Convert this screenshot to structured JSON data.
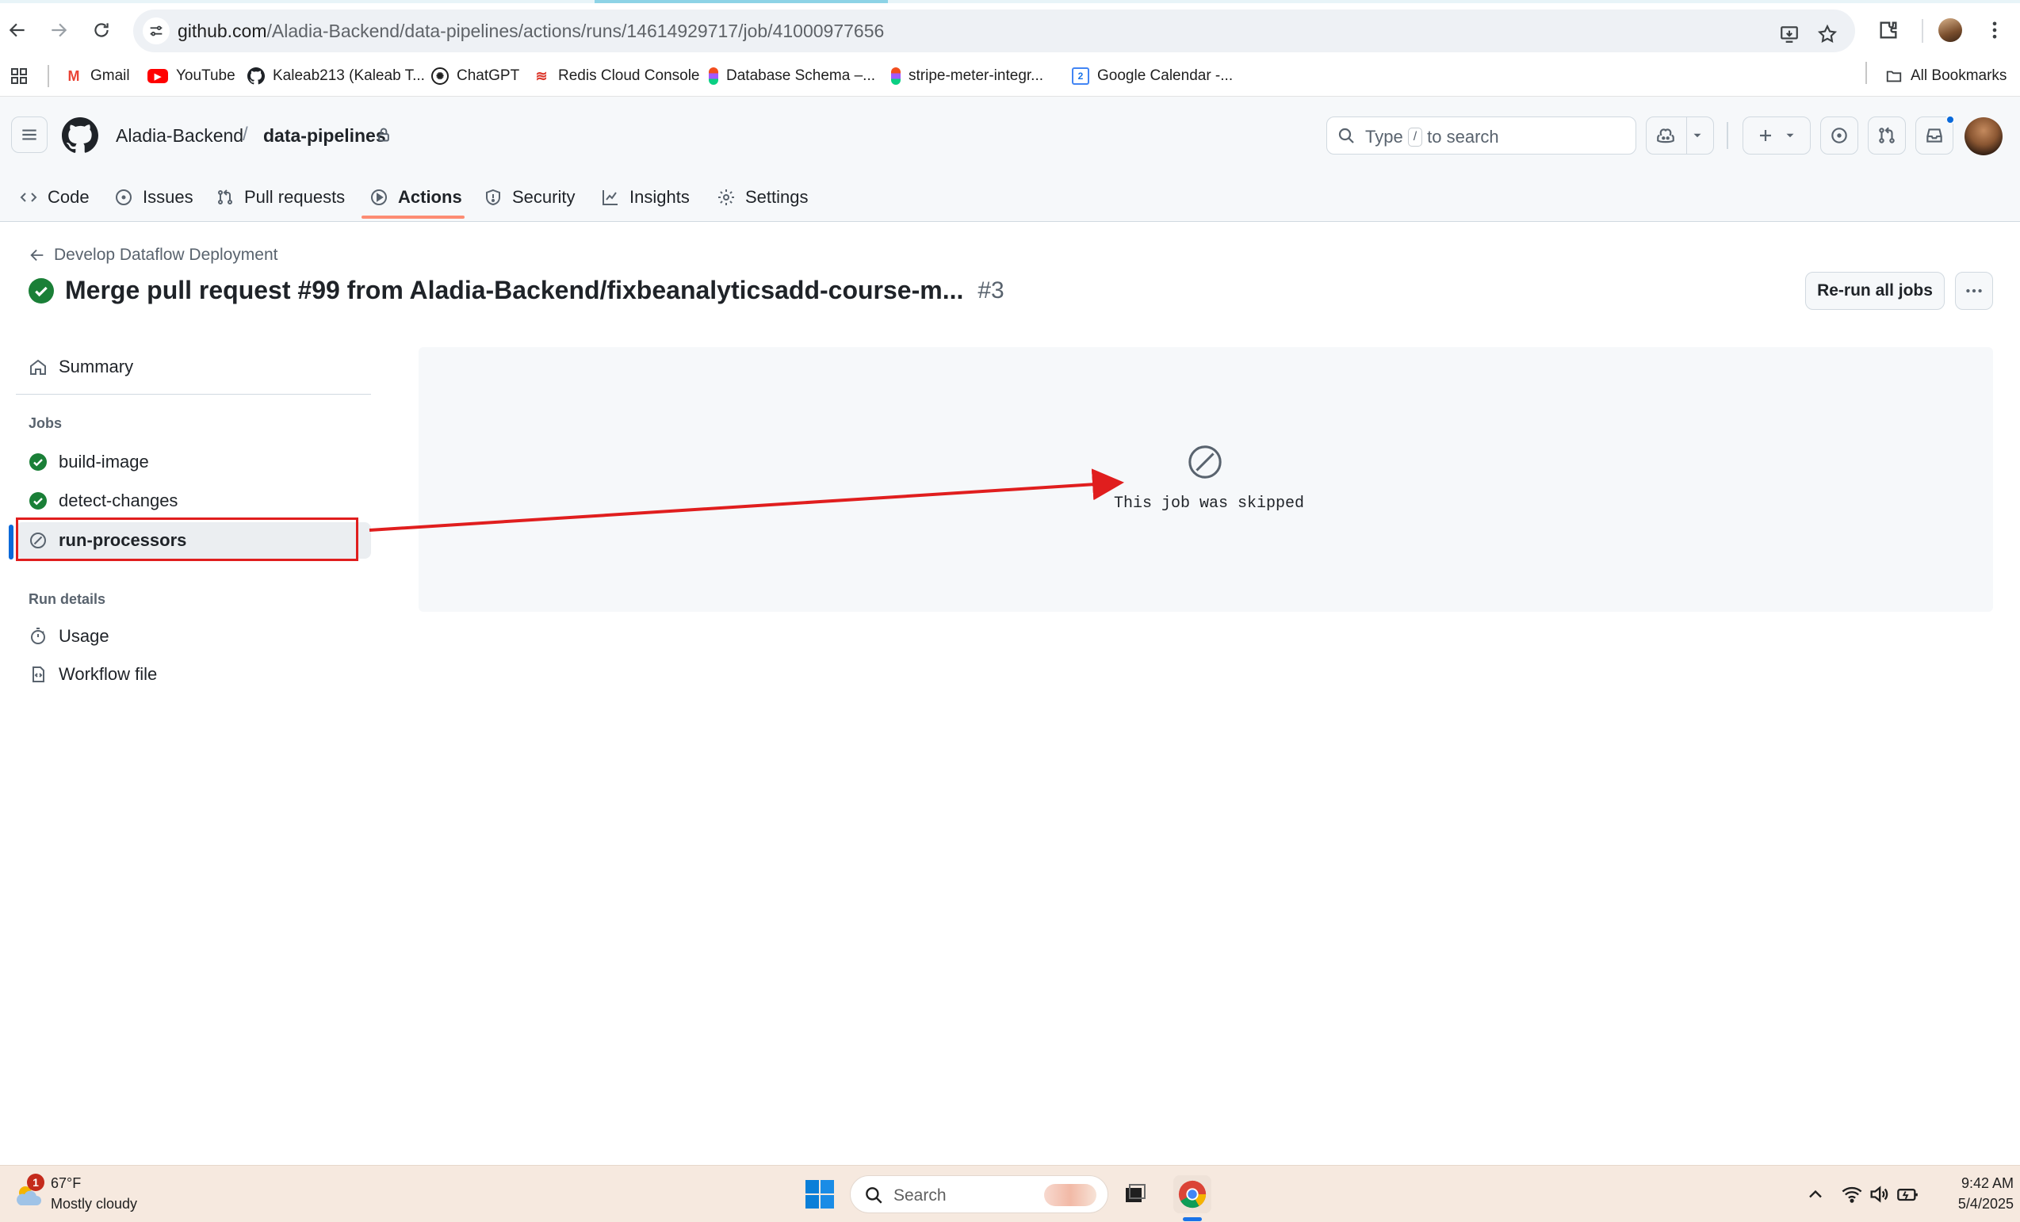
{
  "browser": {
    "url_host": "github.com",
    "url_path": "/Aladia-Backend/data-pipelines/actions/runs/14614929717/job/41000977656",
    "bookmarks": [
      {
        "label": "Gmail",
        "icon": "gmail-icon"
      },
      {
        "label": "YouTube",
        "icon": "youtube-icon"
      },
      {
        "label": "Kaleab213 (Kaleab T...",
        "icon": "github-icon"
      },
      {
        "label": "ChatGPT",
        "icon": "chatgpt-icon"
      },
      {
        "label": "Redis Cloud Console",
        "icon": "redis-icon"
      },
      {
        "label": "Database Schema –...",
        "icon": "figma-icon"
      },
      {
        "label": "stripe-meter-integr...",
        "icon": "figma-icon"
      },
      {
        "label": "Google Calendar -...",
        "icon": "calendar-icon"
      }
    ],
    "all_bookmarks": "All Bookmarks"
  },
  "github": {
    "owner": "Aladia-Backend",
    "separator": "/",
    "repo": "data-pipelines",
    "search_prefix": "Type",
    "search_key": "/",
    "search_suffix": "to search",
    "tabs": [
      {
        "label": "Code",
        "icon": "code-icon"
      },
      {
        "label": "Issues",
        "icon": "issue-icon"
      },
      {
        "label": "Pull requests",
        "icon": "pull-request-icon"
      },
      {
        "label": "Actions",
        "icon": "play-icon",
        "active": true
      },
      {
        "label": "Security",
        "icon": "shield-icon"
      },
      {
        "label": "Insights",
        "icon": "graph-icon"
      },
      {
        "label": "Settings",
        "icon": "gear-icon"
      }
    ]
  },
  "run": {
    "workflow_name": "Develop Dataflow Deployment",
    "title": "Merge pull request #99 from Aladia-Backend/fixbeanalyticsadd-course-m...",
    "number": "#3",
    "rerun_label": "Re-run all jobs"
  },
  "sidebar": {
    "summary": "Summary",
    "jobs_heading": "Jobs",
    "jobs": [
      {
        "label": "build-image",
        "status": "success"
      },
      {
        "label": "detect-changes",
        "status": "success"
      },
      {
        "label": "run-processors",
        "status": "skipped",
        "selected": true
      }
    ],
    "run_details_heading": "Run details",
    "usage": "Usage",
    "workflow_file": "Workflow file"
  },
  "job": {
    "message": "This job was skipped"
  },
  "taskbar": {
    "weather_badge": "1",
    "temperature": "67°F",
    "weather": "Mostly cloudy",
    "search_label": "Search",
    "time": "9:42 AM",
    "date": "5/4/2025"
  },
  "colors": {
    "success": "#1a7f37",
    "accent": "#0969da",
    "tab_underline": "#fd8c73",
    "annotation": "#e01e1e"
  }
}
